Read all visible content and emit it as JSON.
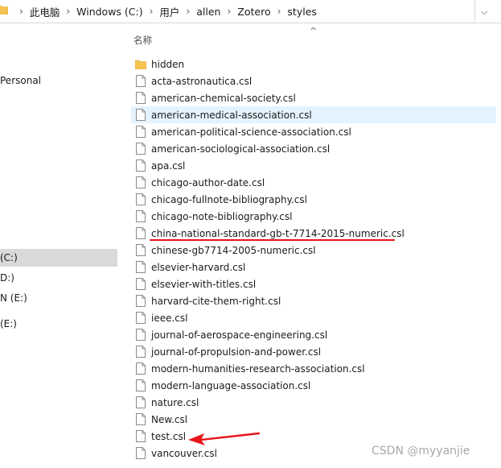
{
  "address": {
    "crumbs": [
      "此电脑",
      "Windows (C:)",
      "用户",
      "allen",
      "Zotero",
      "styles"
    ],
    "separator": "›"
  },
  "nav": {
    "items": [
      {
        "label": "Personal",
        "selected": false
      },
      {
        "label": "(C:)",
        "selected": true
      },
      {
        "label": "D:)",
        "selected": false
      },
      {
        "label": "N (E:)",
        "selected": false
      },
      {
        "label": " (E:)",
        "selected": false
      }
    ]
  },
  "list": {
    "column_header": "名称",
    "sort_glyph": "^",
    "files": [
      {
        "name": "hidden",
        "type": "folder"
      },
      {
        "name": "acta-astronautica.csl",
        "type": "file"
      },
      {
        "name": "american-chemical-society.csl",
        "type": "file"
      },
      {
        "name": "american-medical-association.csl",
        "type": "file",
        "hovered": true
      },
      {
        "name": "american-political-science-association.csl",
        "type": "file"
      },
      {
        "name": "american-sociological-association.csl",
        "type": "file"
      },
      {
        "name": "apa.csl",
        "type": "file"
      },
      {
        "name": "chicago-author-date.csl",
        "type": "file"
      },
      {
        "name": "chicago-fullnote-bibliography.csl",
        "type": "file"
      },
      {
        "name": "chicago-note-bibliography.csl",
        "type": "file"
      },
      {
        "name": "china-national-standard-gb-t-7714-2015-numeric.csl",
        "type": "file"
      },
      {
        "name": "chinese-gb7714-2005-numeric.csl",
        "type": "file"
      },
      {
        "name": "elsevier-harvard.csl",
        "type": "file"
      },
      {
        "name": "elsevier-with-titles.csl",
        "type": "file"
      },
      {
        "name": "harvard-cite-them-right.csl",
        "type": "file"
      },
      {
        "name": "ieee.csl",
        "type": "file"
      },
      {
        "name": "journal-of-aerospace-engineering.csl",
        "type": "file"
      },
      {
        "name": "journal-of-propulsion-and-power.csl",
        "type": "file"
      },
      {
        "name": "modern-humanities-research-association.csl",
        "type": "file"
      },
      {
        "name": "modern-language-association.csl",
        "type": "file"
      },
      {
        "name": "nature.csl",
        "type": "file"
      },
      {
        "name": "New.csl",
        "type": "file"
      },
      {
        "name": "test.csl",
        "type": "file"
      },
      {
        "name": "vancouver.csl",
        "type": "file"
      }
    ]
  },
  "annotations": {
    "color": "#e8141c"
  },
  "watermark": "CSDN @myyanjie"
}
